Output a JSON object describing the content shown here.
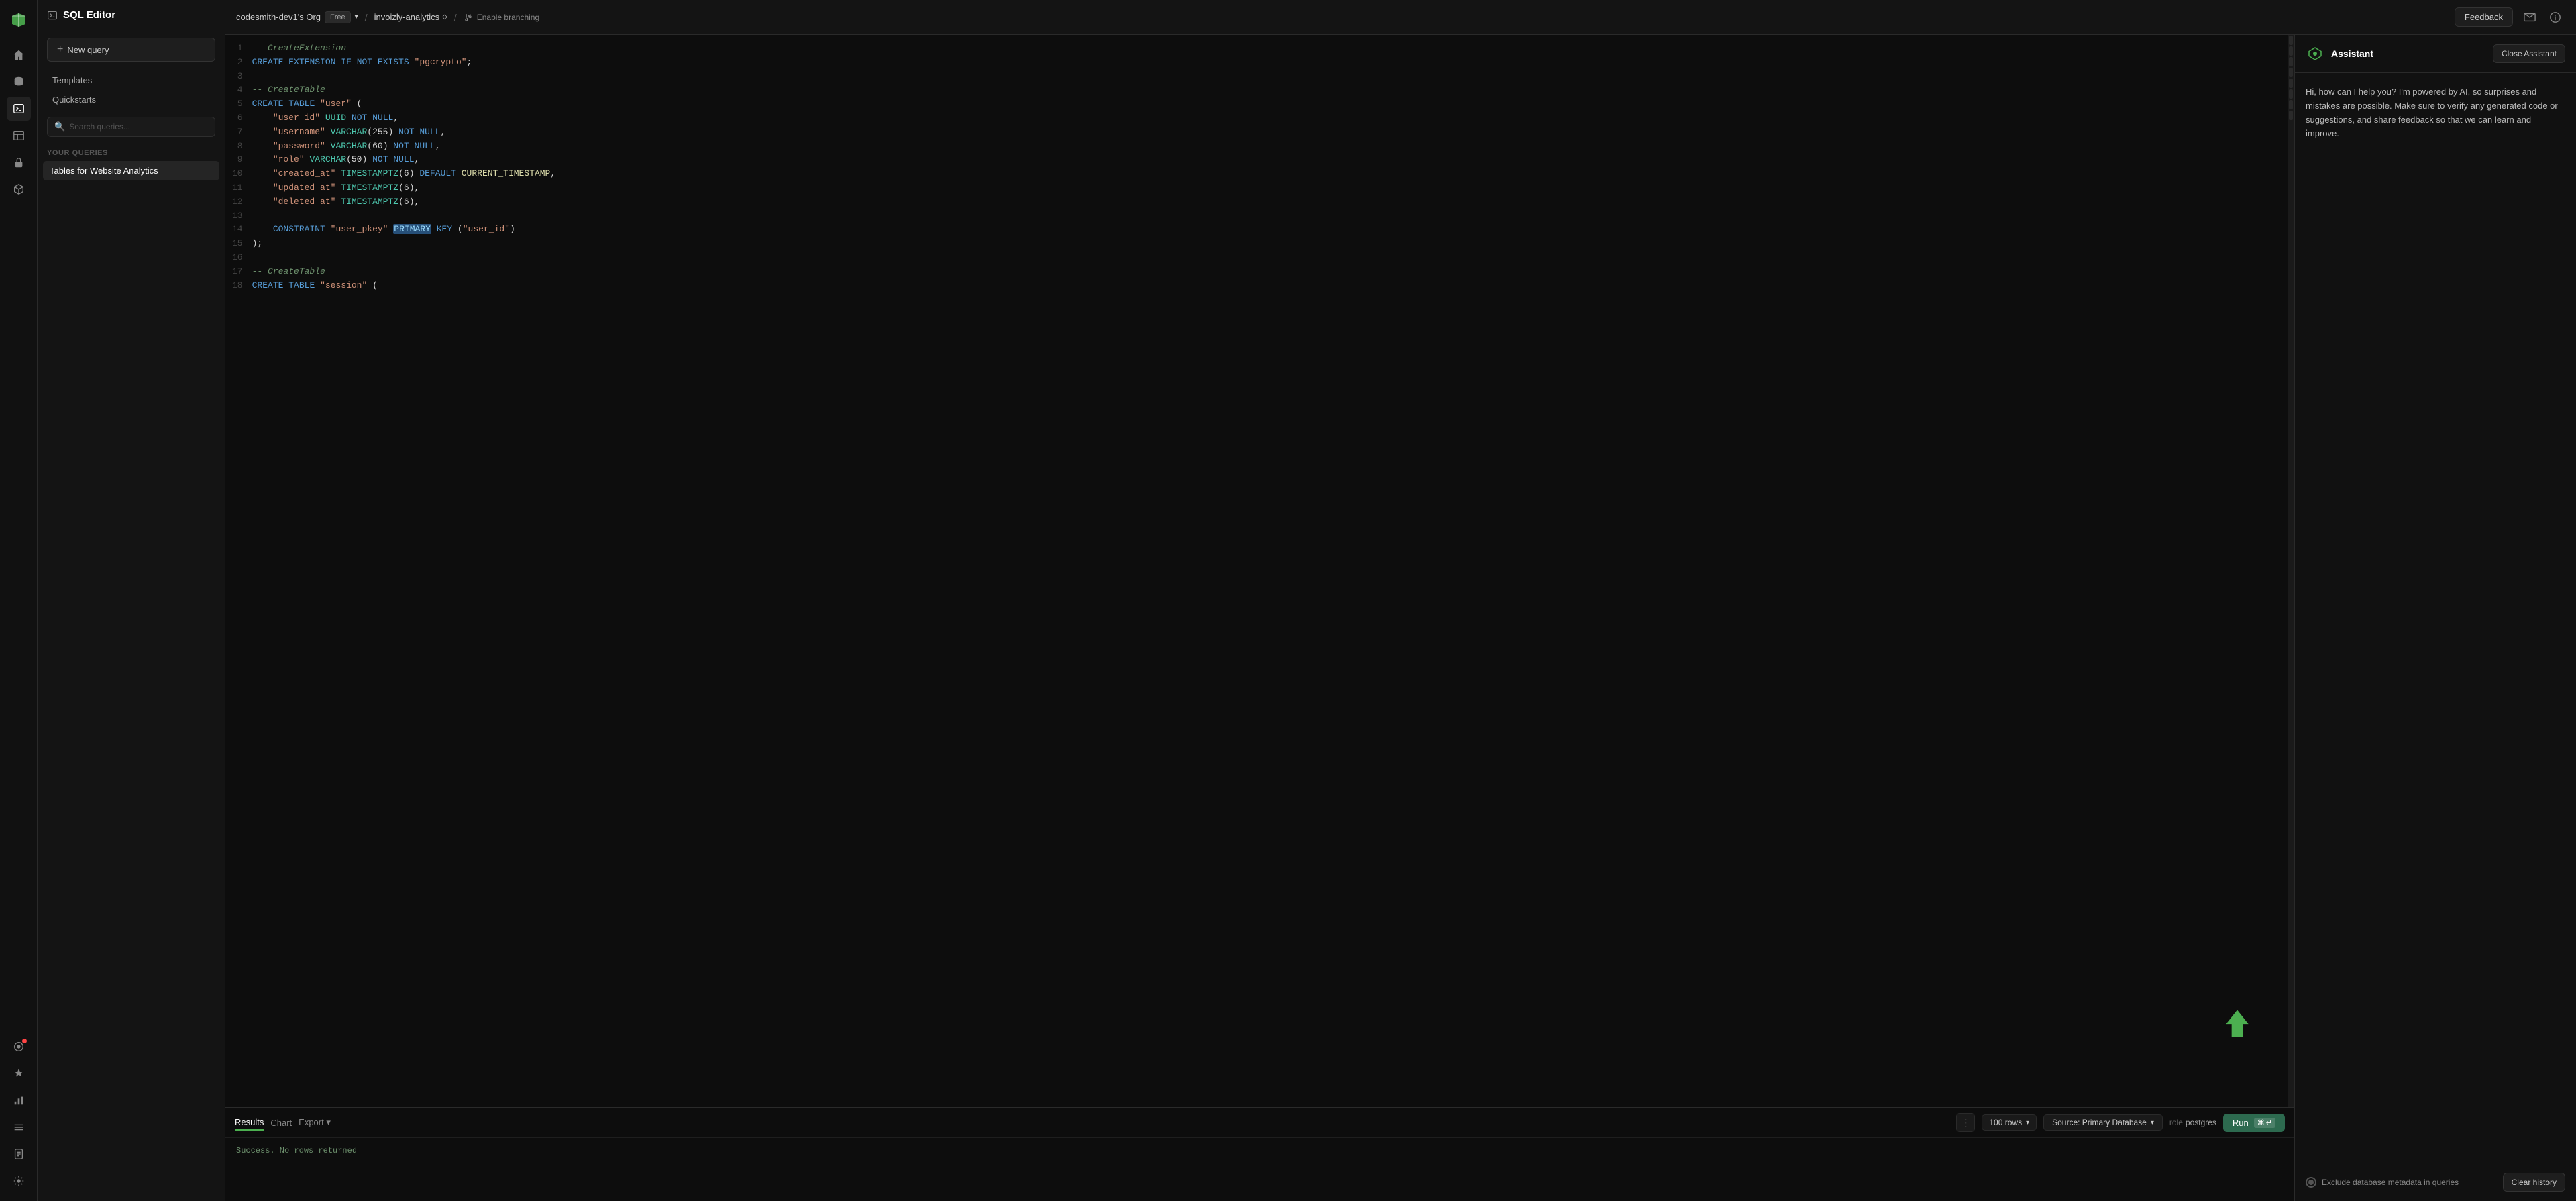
{
  "app": {
    "title": "SQL Editor"
  },
  "topbar": {
    "org_name": "codesmith-dev1's Org",
    "org_badge": "Free",
    "db_name": "invoizly-analytics",
    "branch_label": "Enable branching",
    "feedback_btn": "Feedback"
  },
  "left_panel": {
    "new_query_btn": "New query",
    "templates_label": "Templates",
    "quickstarts_label": "Quickstarts",
    "search_placeholder": "Search queries...",
    "your_queries_label": "YOUR QUERIES",
    "active_query": "Tables for Website Analytics"
  },
  "code": {
    "lines": [
      {
        "num": "1",
        "text": "-- CreateExtension"
      },
      {
        "num": "2",
        "text": "CREATE EXTENSION IF NOT EXISTS \"pgcrypto\";"
      },
      {
        "num": "3",
        "text": ""
      },
      {
        "num": "4",
        "text": "-- CreateTable"
      },
      {
        "num": "5",
        "text": "CREATE TABLE \"user\" ("
      },
      {
        "num": "6",
        "text": "    \"user_id\" UUID NOT NULL,"
      },
      {
        "num": "7",
        "text": "    \"username\" VARCHAR(255) NOT NULL,"
      },
      {
        "num": "8",
        "text": "    \"password\" VARCHAR(60) NOT NULL,"
      },
      {
        "num": "9",
        "text": "    \"role\" VARCHAR(50) NOT NULL,"
      },
      {
        "num": "10",
        "text": "    \"created_at\" TIMESTAMPTZ(6) DEFAULT CURRENT_TIMESTAMP,"
      },
      {
        "num": "11",
        "text": "    \"updated_at\" TIMESTAMPTZ(6),"
      },
      {
        "num": "12",
        "text": "    \"deleted_at\" TIMESTAMPTZ(6),"
      },
      {
        "num": "13",
        "text": ""
      },
      {
        "num": "14",
        "text": "    CONSTRAINT \"user_pkey\" PRIMARY KEY (\"user_id\")"
      },
      {
        "num": "15",
        "text": ");"
      },
      {
        "num": "16",
        "text": ""
      },
      {
        "num": "17",
        "text": "-- CreateTable"
      },
      {
        "num": "18",
        "text": "CREATE TABLE \"session\" ("
      }
    ]
  },
  "bottom_panel": {
    "tabs": [
      "Results",
      "Chart",
      "Export"
    ],
    "active_tab": "Results",
    "rows_label": "100 rows",
    "source_label": "Source: Primary Database",
    "role_prefix": "role",
    "role_value": "postgres",
    "run_btn": "Run",
    "success_text": "Success. No rows returned"
  },
  "assistant": {
    "title": "Assistant",
    "close_btn": "Close Assistant",
    "welcome_text": "Hi, how can I help you? I'm powered by AI, so surprises and mistakes are possible. Make sure to verify any generated code or suggestions, and share feedback so that we can learn and improve.",
    "exclude_label": "Exclude database metadata in queries",
    "clear_btn": "Clear history"
  },
  "sidebar_icons": {
    "home": "⌂",
    "database": "◫",
    "editor": "⬛",
    "table": "▤",
    "lock": "🔒",
    "package": "⬡",
    "activity": "◎",
    "plugin": "✦",
    "chart": "▦",
    "list": "☰",
    "doc": "☰",
    "settings": "⚙"
  }
}
